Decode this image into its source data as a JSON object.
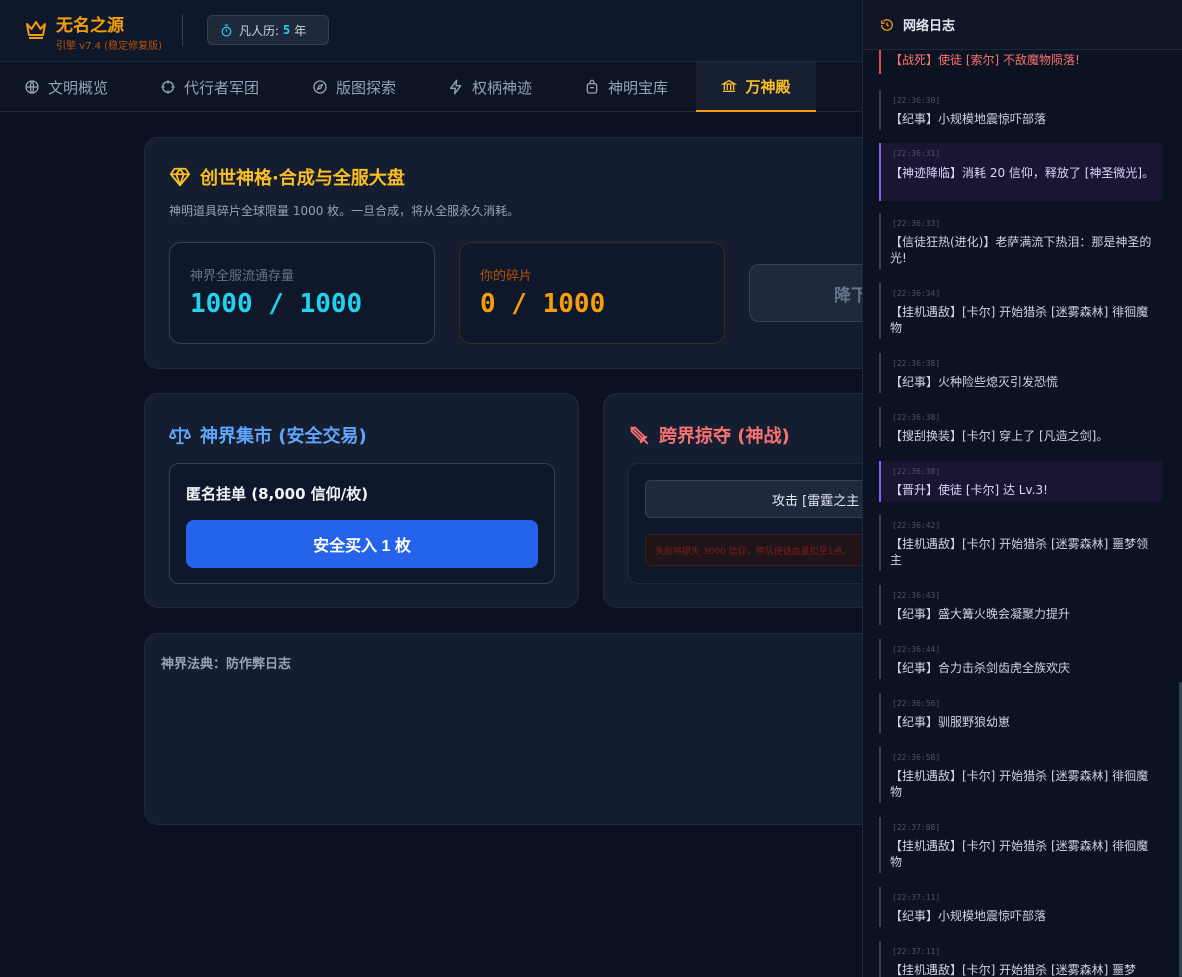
{
  "header": {
    "title": "无名之源",
    "subtitle": "引擎 v7.4 (稳定修复版)",
    "year_label": "凡人历:",
    "year_value": "5",
    "year_unit": "年"
  },
  "tabs": [
    {
      "label": "文明概览",
      "icon": "globe-icon"
    },
    {
      "label": "代行者军团",
      "icon": "crosshair-icon"
    },
    {
      "label": "版图探索",
      "icon": "compass-icon"
    },
    {
      "label": "权柄神迹",
      "icon": "lightning-icon"
    },
    {
      "label": "神明宝库",
      "icon": "backpack-icon"
    },
    {
      "label": "万神殿",
      "icon": "temple-icon",
      "active": true
    }
  ],
  "main": {
    "title": "创世神格·合成与全服大盘",
    "desc": "神明道具碎片全球限量 1000 枚。一旦合成，将从全服永久消耗。",
    "circulation_label": "神界全服流通存量",
    "circulation_value": "1000 / 1000",
    "yours_label": "你的碎片",
    "yours_value": "0 / 1000",
    "forge_button": "降下"
  },
  "market": {
    "title": "神界集市 (安全交易)",
    "listing": "匿名挂单 (8,000 信仰/枚)",
    "buy_button": "安全买入 1 枚"
  },
  "raid": {
    "title": "跨界掠夺 (神战)",
    "attack_button": "攻击 [雷霆之主",
    "warning": "失败将损失 3000 信仰，带队使徒血量扣至1点。"
  },
  "law": {
    "title": "神界法典：防作弊日志"
  },
  "log": {
    "title": "网络日志",
    "entries": [
      {
        "time": "",
        "text": "【战死】使徒 [索尔] 不敌魔物陨落!",
        "type": "death"
      },
      {
        "time": "[22:36:30]",
        "text": "【纪事】小规模地震惊吓部落",
        "type": "normal"
      },
      {
        "time": "[22:36:31]",
        "text": "【神迹降临】消耗 20 信仰，释放了 [神圣微光]。",
        "type": "divine"
      },
      {
        "time": "[22:36:33]",
        "text": "【信徒狂热(进化)】老萨满流下热泪：那是神圣的光!",
        "type": "normal"
      },
      {
        "time": "[22:36:34]",
        "text": "【挂机遇敌】[卡尔] 开始猎杀 [迷雾森林] 徘徊魔物",
        "type": "normal"
      },
      {
        "time": "[22:36:38]",
        "text": "【纪事】火种险些熄灭引发恐慌",
        "type": "normal"
      },
      {
        "time": "[22:36:38]",
        "text": "【搜刮换装】[卡尔] 穿上了 [凡造之剑]。",
        "type": "normal"
      },
      {
        "time": "[22:36:38]",
        "text": "【晋升】使徒 [卡尔] 达 Lv.3!",
        "type": "divine"
      },
      {
        "time": "[22:36:42]",
        "text": "【挂机遇敌】[卡尔] 开始猎杀 [迷雾森林] 噩梦领主",
        "type": "normal"
      },
      {
        "time": "[22:36:43]",
        "text": "【纪事】盛大篝火晚会凝聚力提升",
        "type": "normal"
      },
      {
        "time": "[22:36:44]",
        "text": "【纪事】合力击杀剑齿虎全族欢庆",
        "type": "normal"
      },
      {
        "time": "[22:36:56]",
        "text": "【纪事】驯服野狼幼崽",
        "type": "normal"
      },
      {
        "time": "[22:36:58]",
        "text": "【挂机遇敌】[卡尔] 开始猎杀 [迷雾森林] 徘徊魔物",
        "type": "normal"
      },
      {
        "time": "[22:37:08]",
        "text": "【挂机遇敌】[卡尔] 开始猎杀 [迷雾森林] 徘徊魔物",
        "type": "normal"
      },
      {
        "time": "[22:37:11]",
        "text": "【纪事】小规模地震惊吓部落",
        "type": "normal"
      },
      {
        "time": "[22:37:11]",
        "text": "【挂机遇敌】[卡尔] 开始猎杀 [迷雾森林] 噩梦",
        "type": "normal"
      }
    ]
  },
  "colors": {
    "accent": "#f59e0b",
    "cyan": "#22d3ee",
    "blue": "#2563eb",
    "danger": "#ef4444",
    "divine": "#8b5cf6"
  }
}
